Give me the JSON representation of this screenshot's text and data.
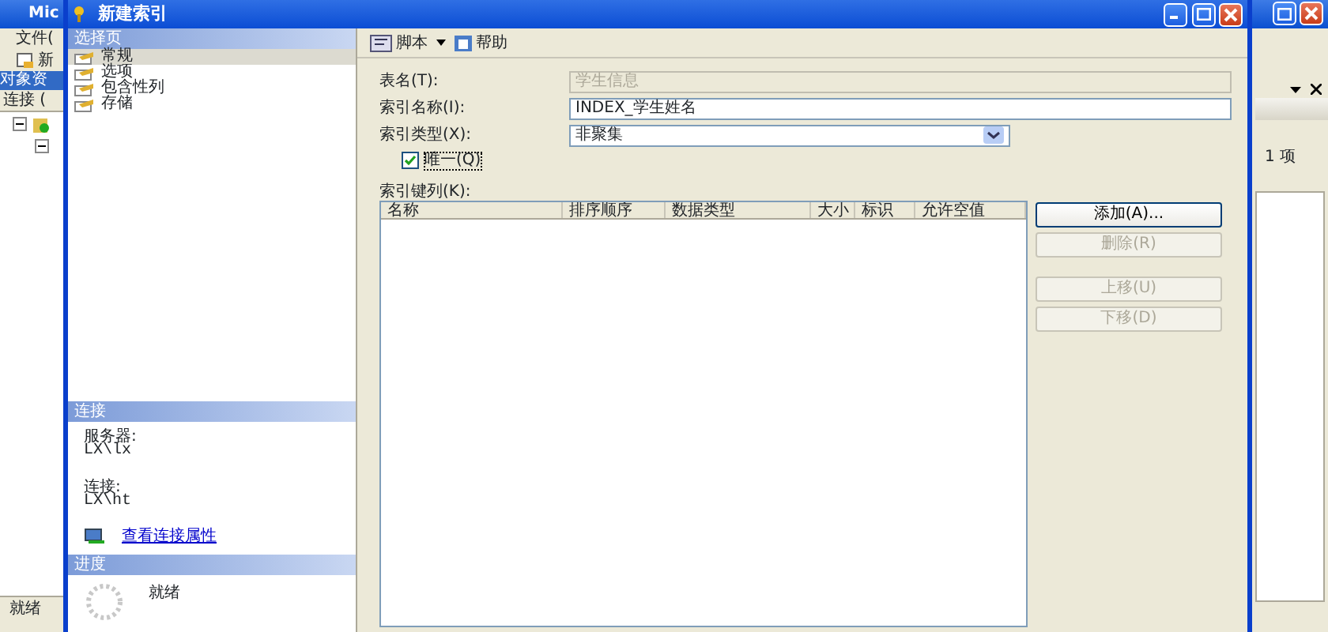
{
  "background_window": {
    "title": "Mic",
    "menu": [
      "文件("
    ],
    "toolbar": [
      "新"
    ],
    "panel_title": "对象资",
    "connect": "连接 (",
    "status": "就绪",
    "count": "1 项"
  },
  "dialog": {
    "title": "新建索引",
    "select_page": {
      "header": "选择页",
      "items": [
        {
          "label": "常规",
          "selected": true
        },
        {
          "label": "选项",
          "selected": false
        },
        {
          "label": "包含性列",
          "selected": false
        },
        {
          "label": "存储",
          "selected": false
        }
      ]
    },
    "connection": {
      "header": "连接",
      "server_label": "服务器:",
      "server": "LX\\lx",
      "connection_label": "连接:",
      "connection": "LX\\ht",
      "link": "查看连接属性"
    },
    "progress": {
      "header": "进度",
      "status": "就绪"
    },
    "toolbar": [
      {
        "label": "脚本",
        "dropdown": true
      },
      {
        "label": "帮助",
        "dropdown": false
      }
    ],
    "fields": [
      {
        "label": "表名(T):",
        "value": "学生信息",
        "disabled": true,
        "kind": "text"
      },
      {
        "label": "索引名称(I):",
        "value": "INDEX_学生姓名",
        "disabled": false,
        "kind": "text"
      },
      {
        "label": "索引类型(X):",
        "value": "非聚集",
        "disabled": false,
        "kind": "select"
      }
    ],
    "unique": {
      "label": "唯一(Q)",
      "checked": true
    },
    "key_columns": {
      "label": "索引键列(K):",
      "columns": [
        "名称",
        "排序顺序",
        "数据类型",
        "大小",
        "标识",
        "允许空值"
      ]
    },
    "buttons": [
      {
        "label": "添加(A)...",
        "disabled": false,
        "kind": "primary"
      },
      {
        "label": "删除(R)",
        "disabled": true,
        "kind": "normal"
      },
      {
        "label": "上移(U)",
        "disabled": true,
        "kind": "gap"
      },
      {
        "label": "下移(D)",
        "disabled": true,
        "kind": "normal"
      }
    ]
  }
}
